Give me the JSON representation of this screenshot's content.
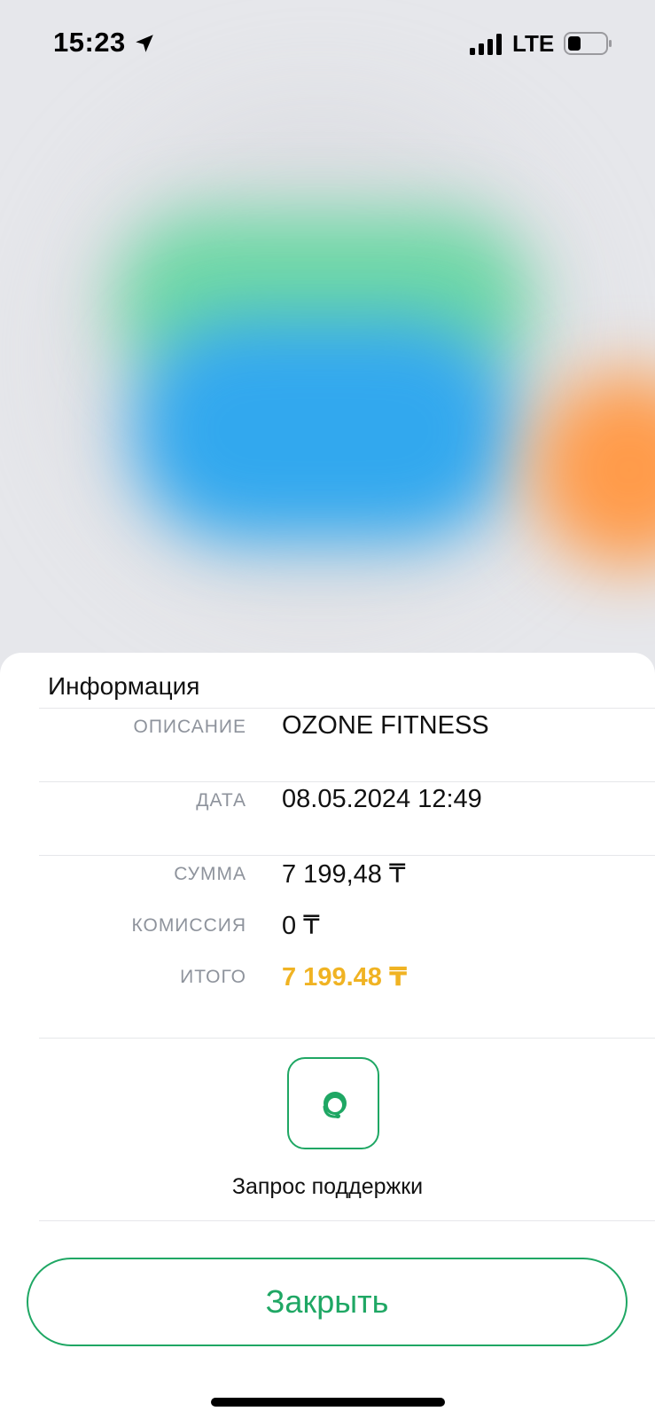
{
  "status_bar": {
    "time": "15:23",
    "network": "LTE",
    "icons": [
      "location-arrow-icon",
      "cellular-signal-icon",
      "battery-icon"
    ]
  },
  "sheet": {
    "title": "Информация",
    "rows": [
      {
        "label": "ОПИСАНИЕ",
        "value": "OZONE FITNESS"
      },
      {
        "label": "ДАТА",
        "value": "08.05.2024 12:49"
      },
      {
        "label": "СУММА",
        "value": "7 199,48 ₸"
      },
      {
        "label": "КОМИССИЯ",
        "value": "0 ₸"
      },
      {
        "label": "ИТОГО",
        "value": "7 199.48 ₸"
      }
    ],
    "support": {
      "label": "Запрос поддержки",
      "icon": "support-agent-icon"
    },
    "close_label": "Закрыть"
  },
  "colors": {
    "accent_green": "#1fa764",
    "total_yellow": "#f0b323",
    "label_gray": "#8e939c"
  }
}
